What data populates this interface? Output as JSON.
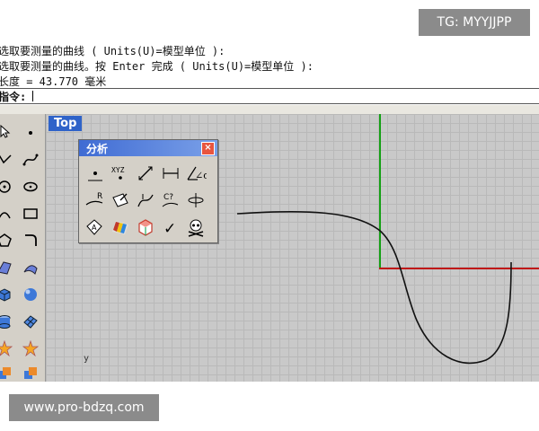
{
  "watermarks": {
    "top": "TG: MYYJJPP",
    "bottom": "www.pro-bdzq.com"
  },
  "command_history": [
    "选取要测量的曲线 ( Units(U)=模型单位 ):",
    "选取要测量的曲线。按 Enter 完成 ( Units(U)=模型单位 ):",
    "长度 = 43.770 毫米"
  ],
  "command_prompt": {
    "label": "指令:",
    "value": ""
  },
  "viewport": {
    "title": "Top",
    "world_axis_label": "y",
    "colors": {
      "grid_bg": "#c9c9c9",
      "y_axis": "#15a015",
      "x_axis": "#c01818",
      "title_bg": "#2f63c9"
    }
  },
  "analysis_panel": {
    "title": "分析",
    "close_label": "×",
    "buttons": [
      {
        "name": "point-icon"
      },
      {
        "name": "xyz-coordinate-icon",
        "label": "XYZ"
      },
      {
        "name": "distance-icon"
      },
      {
        "name": "length-icon"
      },
      {
        "name": "angle-icon",
        "label": "∠α"
      },
      {
        "name": "radius-icon",
        "label": "R"
      },
      {
        "name": "direction-icon"
      },
      {
        "name": "curvature-icon"
      },
      {
        "name": "continuity-icon",
        "label": "C?"
      },
      {
        "name": "deviation-icon"
      },
      {
        "name": "area-icon",
        "label": "A"
      },
      {
        "name": "zebra-analysis-icon"
      },
      {
        "name": "curvature-graph-icon"
      },
      {
        "name": "check-icon",
        "label": "✓"
      },
      {
        "name": "skull-icon"
      }
    ]
  },
  "left_toolbar": {
    "tools": [
      "select-arrow-icon",
      "point-icon",
      "polyline-icon",
      "curve-icon",
      "circle-icon",
      "ellipse-icon",
      "arc-icon",
      "rectangle-icon",
      "polygon-icon",
      "fillet-icon",
      "surface-icon",
      "surface-edge-icon",
      "box-icon",
      "sphere-icon",
      "cylinder-icon",
      "mesh-icon",
      "explode-icon",
      "boolean-icon"
    ]
  }
}
